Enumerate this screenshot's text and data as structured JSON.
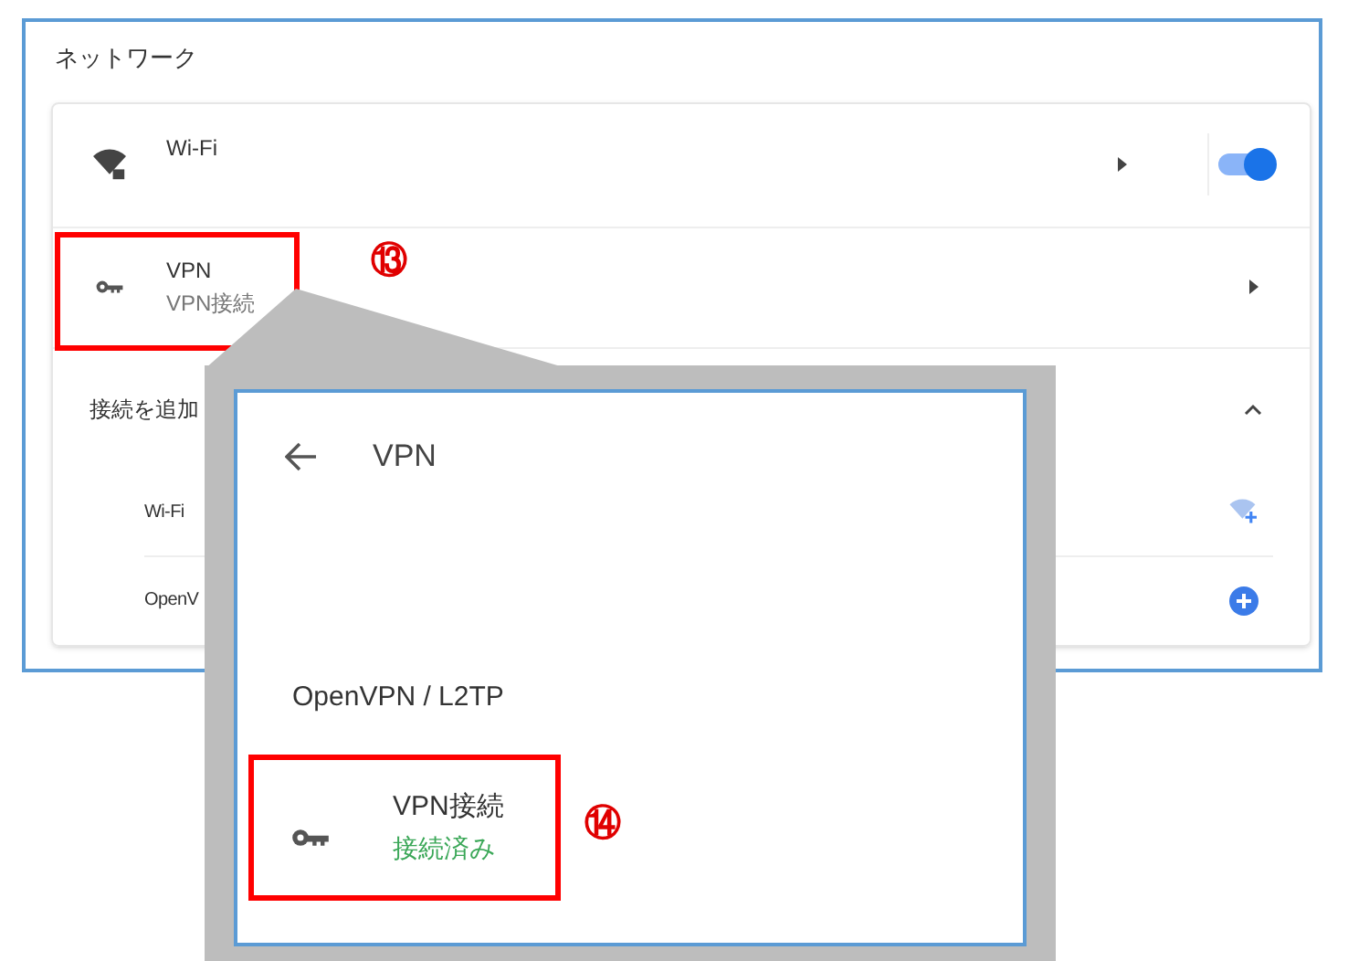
{
  "section_title": "ネットワーク",
  "rows": [
    {
      "kind": "wifi",
      "title": "Wi-Fi",
      "on": true
    },
    {
      "kind": "vpn",
      "title": "VPN",
      "subtitle": "VPN接続"
    }
  ],
  "add_connection": {
    "title": "接続を追加",
    "expanded": true,
    "items": [
      {
        "kind": "wifi",
        "label": "Wi-Fi"
      },
      {
        "kind": "openvpn",
        "label": "OpenV"
      }
    ]
  },
  "callout": {
    "title": "VPN",
    "group": "OpenVPN / L2TP",
    "entry": {
      "name": "VPN接続",
      "status": "接続済み"
    }
  },
  "markers": [
    "⑬",
    "⑭"
  ]
}
